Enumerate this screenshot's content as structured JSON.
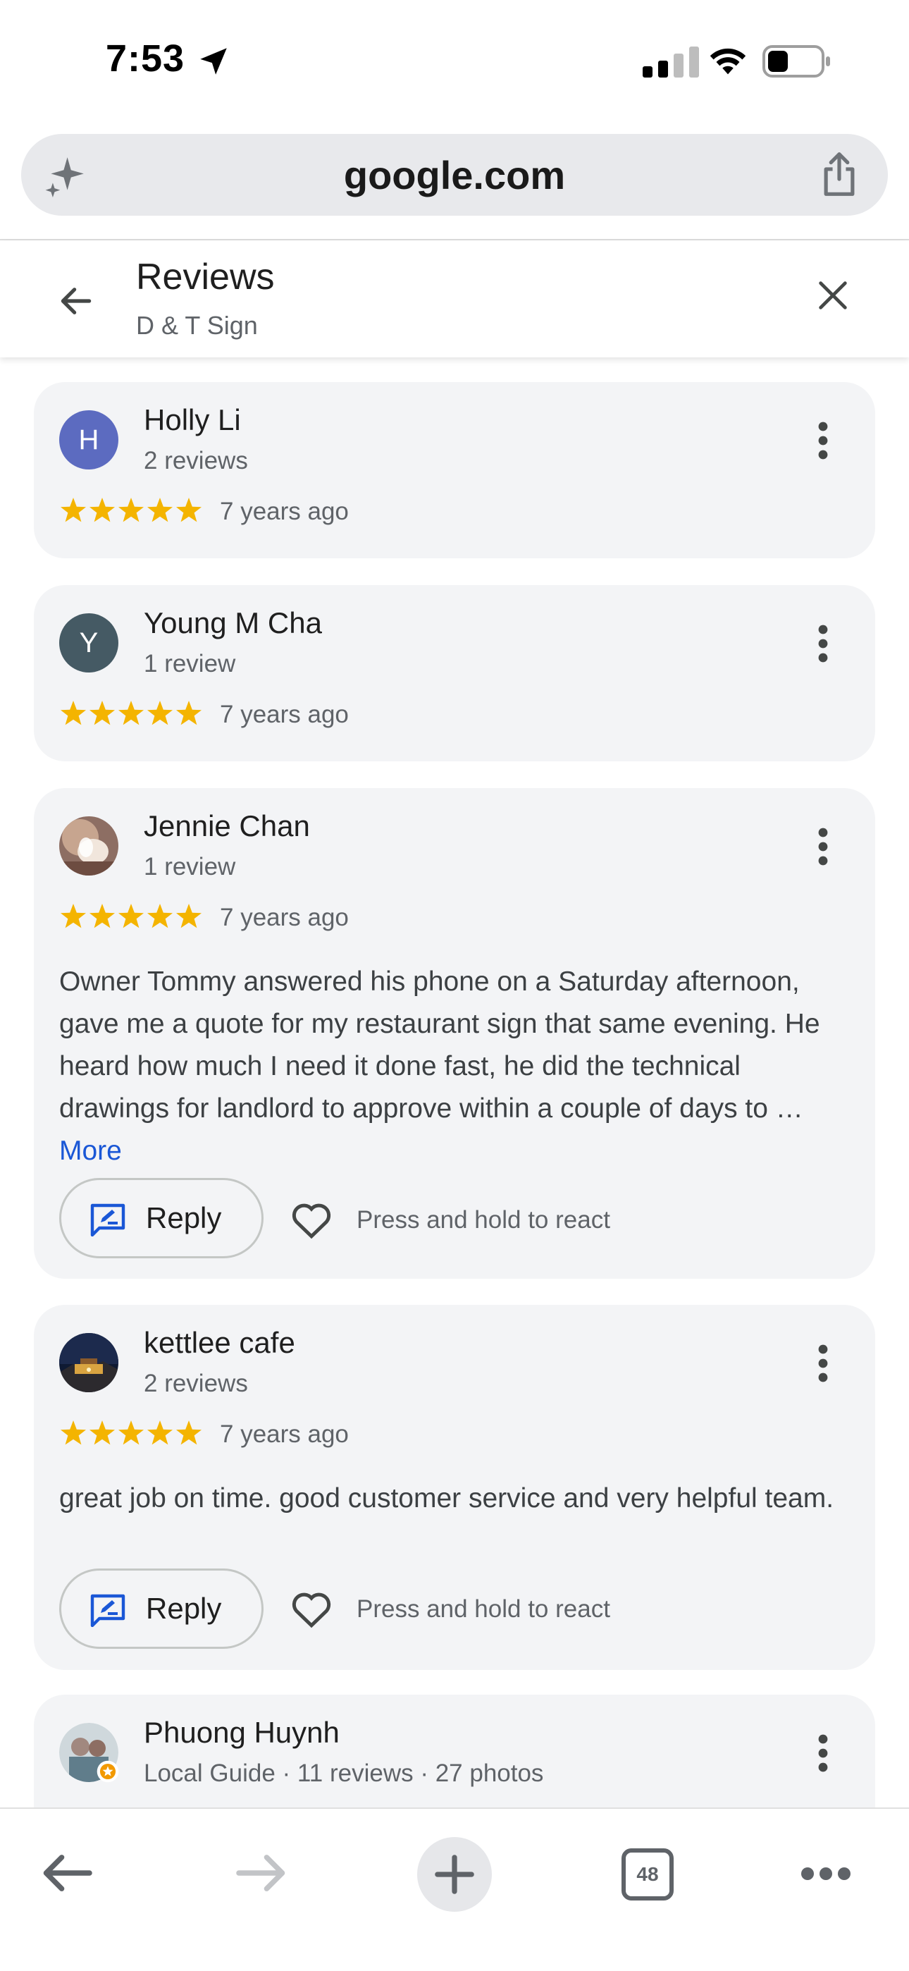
{
  "status_bar": {
    "time": "7:53"
  },
  "browser": {
    "url": "google.com",
    "tab_count": "48"
  },
  "header": {
    "title": "Reviews",
    "subtitle": "D & T Sign"
  },
  "reviews": [
    {
      "initial": "H",
      "name": "Holly Li",
      "meta": "2 reviews",
      "rating": 5,
      "time": "7 years ago",
      "avatar_color": "#5c6bc0"
    },
    {
      "initial": "Y",
      "name": "Young M Cha",
      "meta": "1 review",
      "rating": 5,
      "time": "7 years ago",
      "avatar_color": "#455a64"
    },
    {
      "name": "Jennie Chan",
      "meta": "1 review",
      "rating": 5,
      "time": "7 years ago",
      "text": "Owner Tommy answered his phone on a Saturday afternoon, gave me a quote for my restaurant sign that same evening. He heard how much I need it done fast, he did the technical drawings for landlord to approve within a couple of days to …",
      "more": "More"
    },
    {
      "name": "kettlee cafe",
      "meta": "2 reviews",
      "rating": 5,
      "time": "7 years ago",
      "text": "great job on time. good customer service and very helpful team."
    },
    {
      "name": "Phuong Huynh",
      "meta": "Local Guide · 11 reviews · 27 photos"
    }
  ],
  "actions": {
    "reply_label": "Reply",
    "react_hint": "Press and hold to react"
  },
  "colors": {
    "star": "#f4b400",
    "link": "#1a57d6",
    "card_bg": "#f3f4f6"
  }
}
